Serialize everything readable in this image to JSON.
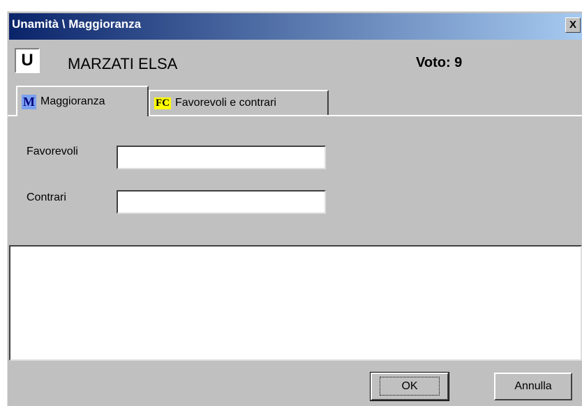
{
  "window": {
    "title": "Unamità \\ Maggioranza",
    "close_label": "X"
  },
  "header": {
    "user_badge": "U",
    "person_name": "MARZATI ELSA",
    "vote_text": "Voto: 9"
  },
  "tabs": [
    {
      "icon_text": "M",
      "label": "Maggioranza",
      "active": true
    },
    {
      "icon_text": "FC",
      "label": "Favorevoli e contrari",
      "active": false
    }
  ],
  "form": {
    "favorevoli_label": "Favorevoli",
    "favorevoli_value": "",
    "contrari_label": "Contrari",
    "contrari_value": ""
  },
  "buttons": {
    "ok_label": "OK",
    "annulla_label": "Annulla"
  }
}
